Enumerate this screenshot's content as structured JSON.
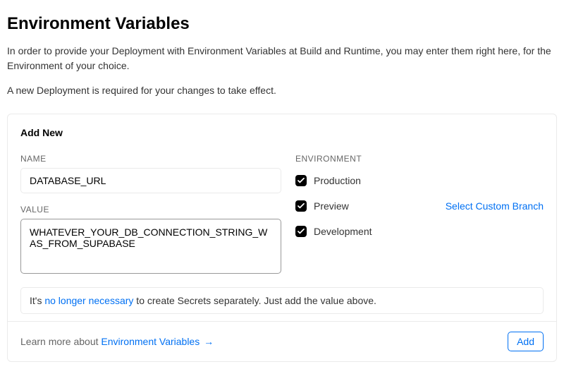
{
  "header": {
    "title": "Environment Variables",
    "description1": "In order to provide your Deployment with Environment Variables at Build and Runtime, you may enter them right here, for the Environment of your choice.",
    "description2": "A new Deployment is required for your changes to take effect."
  },
  "panel": {
    "title": "Add New",
    "nameLabel": "NAME",
    "nameValue": "DATABASE_URL",
    "valueLabel": "VALUE",
    "valueValue": "WHATEVER_YOUR_DB_CONNECTION_STRING_WAS_FROM_SUPABASE",
    "envLabel": "ENVIRONMENT",
    "environments": {
      "production": "Production",
      "preview": "Preview",
      "development": "Development"
    },
    "customBranchLink": "Select Custom Branch",
    "notice": {
      "prefix": "It's ",
      "link": "no longer necessary",
      "suffix": " to create Secrets separately. Just add the value above."
    }
  },
  "footer": {
    "learnPrefix": "Learn more about ",
    "learnLink": "Environment Variables",
    "arrow": "→",
    "addButton": "Add"
  }
}
